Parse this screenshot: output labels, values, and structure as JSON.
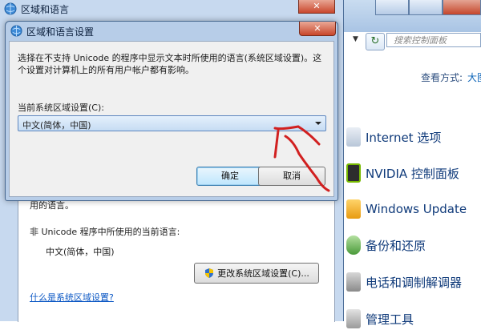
{
  "colors": {
    "annotation": "#d12020",
    "link": "#0b57c4",
    "window_chrome": "#b7cde8"
  },
  "control_panel": {
    "search_placeholder": "搜索控制面板",
    "view_by_label": "查看方式:",
    "view_by_value": "大图",
    "items": [
      {
        "label": "Internet 选项",
        "icon": "internet-options-icon"
      },
      {
        "label": "NVIDIA 控制面板",
        "icon": "nvidia-icon"
      },
      {
        "label": "Windows Update",
        "icon": "windows-update-icon"
      },
      {
        "label": "备份和还原",
        "icon": "backup-icon"
      },
      {
        "label": "电话和调制解调器",
        "icon": "phone-modem-icon"
      },
      {
        "label": "管理工具",
        "icon": "admin-tools-icon"
      }
    ]
  },
  "region_dialog": {
    "title": "区域和语言",
    "close_label": "✕",
    "partial_text": "用的语言。",
    "nonunicode_label": "非 Unicode 程序中所使用的当前语言:",
    "nonunicode_value": "中文(简体，中国)",
    "change_locale_button": "更改系统区域设置(C)...",
    "what_is_link": "什么是系统区域设置?"
  },
  "locale_dialog": {
    "title": "区域和语言设置",
    "close_label": "✕",
    "description": "选择在不支持 Unicode 的程序中显示文本时所使用的语言(系统区域设置)。这个设置对计算机上的所有用户帐户都有影响。",
    "current_label": "当前系统区域设置(C):",
    "current_value": "中文(简体，中国)",
    "ok_button": "确定",
    "cancel_button": "取消"
  }
}
